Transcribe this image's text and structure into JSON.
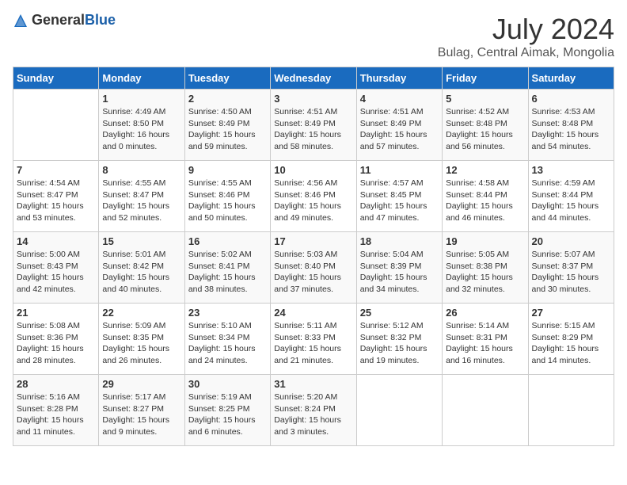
{
  "logo": {
    "text_general": "General",
    "text_blue": "Blue"
  },
  "title": "July 2024",
  "location": "Bulag, Central Aimak, Mongolia",
  "days_of_week": [
    "Sunday",
    "Monday",
    "Tuesday",
    "Wednesday",
    "Thursday",
    "Friday",
    "Saturday"
  ],
  "weeks": [
    [
      {
        "day": "",
        "info": ""
      },
      {
        "day": "1",
        "info": "Sunrise: 4:49 AM\nSunset: 8:50 PM\nDaylight: 16 hours\nand 0 minutes."
      },
      {
        "day": "2",
        "info": "Sunrise: 4:50 AM\nSunset: 8:49 PM\nDaylight: 15 hours\nand 59 minutes."
      },
      {
        "day": "3",
        "info": "Sunrise: 4:51 AM\nSunset: 8:49 PM\nDaylight: 15 hours\nand 58 minutes."
      },
      {
        "day": "4",
        "info": "Sunrise: 4:51 AM\nSunset: 8:49 PM\nDaylight: 15 hours\nand 57 minutes."
      },
      {
        "day": "5",
        "info": "Sunrise: 4:52 AM\nSunset: 8:48 PM\nDaylight: 15 hours\nand 56 minutes."
      },
      {
        "day": "6",
        "info": "Sunrise: 4:53 AM\nSunset: 8:48 PM\nDaylight: 15 hours\nand 54 minutes."
      }
    ],
    [
      {
        "day": "7",
        "info": "Sunrise: 4:54 AM\nSunset: 8:47 PM\nDaylight: 15 hours\nand 53 minutes."
      },
      {
        "day": "8",
        "info": "Sunrise: 4:55 AM\nSunset: 8:47 PM\nDaylight: 15 hours\nand 52 minutes."
      },
      {
        "day": "9",
        "info": "Sunrise: 4:55 AM\nSunset: 8:46 PM\nDaylight: 15 hours\nand 50 minutes."
      },
      {
        "day": "10",
        "info": "Sunrise: 4:56 AM\nSunset: 8:46 PM\nDaylight: 15 hours\nand 49 minutes."
      },
      {
        "day": "11",
        "info": "Sunrise: 4:57 AM\nSunset: 8:45 PM\nDaylight: 15 hours\nand 47 minutes."
      },
      {
        "day": "12",
        "info": "Sunrise: 4:58 AM\nSunset: 8:44 PM\nDaylight: 15 hours\nand 46 minutes."
      },
      {
        "day": "13",
        "info": "Sunrise: 4:59 AM\nSunset: 8:44 PM\nDaylight: 15 hours\nand 44 minutes."
      }
    ],
    [
      {
        "day": "14",
        "info": "Sunrise: 5:00 AM\nSunset: 8:43 PM\nDaylight: 15 hours\nand 42 minutes."
      },
      {
        "day": "15",
        "info": "Sunrise: 5:01 AM\nSunset: 8:42 PM\nDaylight: 15 hours\nand 40 minutes."
      },
      {
        "day": "16",
        "info": "Sunrise: 5:02 AM\nSunset: 8:41 PM\nDaylight: 15 hours\nand 38 minutes."
      },
      {
        "day": "17",
        "info": "Sunrise: 5:03 AM\nSunset: 8:40 PM\nDaylight: 15 hours\nand 37 minutes."
      },
      {
        "day": "18",
        "info": "Sunrise: 5:04 AM\nSunset: 8:39 PM\nDaylight: 15 hours\nand 34 minutes."
      },
      {
        "day": "19",
        "info": "Sunrise: 5:05 AM\nSunset: 8:38 PM\nDaylight: 15 hours\nand 32 minutes."
      },
      {
        "day": "20",
        "info": "Sunrise: 5:07 AM\nSunset: 8:37 PM\nDaylight: 15 hours\nand 30 minutes."
      }
    ],
    [
      {
        "day": "21",
        "info": "Sunrise: 5:08 AM\nSunset: 8:36 PM\nDaylight: 15 hours\nand 28 minutes."
      },
      {
        "day": "22",
        "info": "Sunrise: 5:09 AM\nSunset: 8:35 PM\nDaylight: 15 hours\nand 26 minutes."
      },
      {
        "day": "23",
        "info": "Sunrise: 5:10 AM\nSunset: 8:34 PM\nDaylight: 15 hours\nand 24 minutes."
      },
      {
        "day": "24",
        "info": "Sunrise: 5:11 AM\nSunset: 8:33 PM\nDaylight: 15 hours\nand 21 minutes."
      },
      {
        "day": "25",
        "info": "Sunrise: 5:12 AM\nSunset: 8:32 PM\nDaylight: 15 hours\nand 19 minutes."
      },
      {
        "day": "26",
        "info": "Sunrise: 5:14 AM\nSunset: 8:31 PM\nDaylight: 15 hours\nand 16 minutes."
      },
      {
        "day": "27",
        "info": "Sunrise: 5:15 AM\nSunset: 8:29 PM\nDaylight: 15 hours\nand 14 minutes."
      }
    ],
    [
      {
        "day": "28",
        "info": "Sunrise: 5:16 AM\nSunset: 8:28 PM\nDaylight: 15 hours\nand 11 minutes."
      },
      {
        "day": "29",
        "info": "Sunrise: 5:17 AM\nSunset: 8:27 PM\nDaylight: 15 hours\nand 9 minutes."
      },
      {
        "day": "30",
        "info": "Sunrise: 5:19 AM\nSunset: 8:25 PM\nDaylight: 15 hours\nand 6 minutes."
      },
      {
        "day": "31",
        "info": "Sunrise: 5:20 AM\nSunset: 8:24 PM\nDaylight: 15 hours\nand 3 minutes."
      },
      {
        "day": "",
        "info": ""
      },
      {
        "day": "",
        "info": ""
      },
      {
        "day": "",
        "info": ""
      }
    ]
  ]
}
